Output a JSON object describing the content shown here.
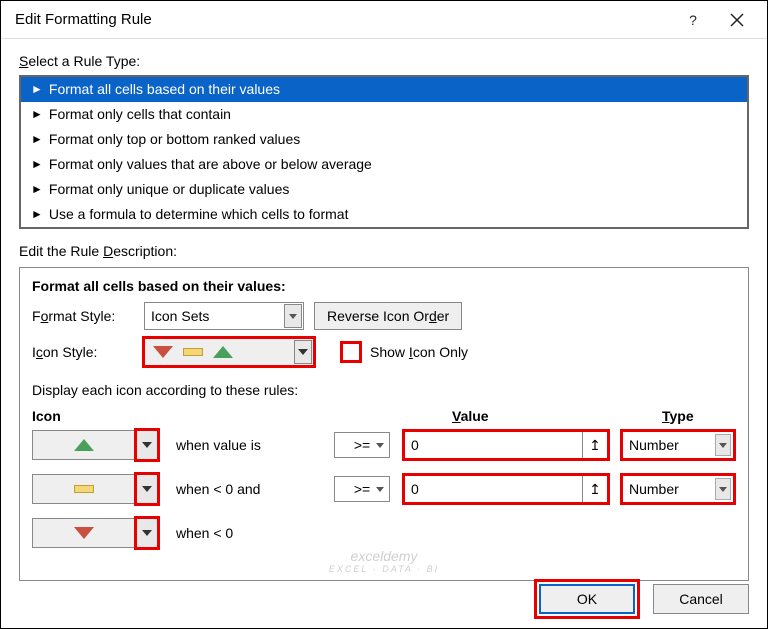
{
  "title": "Edit Formatting Rule",
  "section_rule_type_pre": "S",
  "section_rule_type_post": "elect a Rule Type:",
  "rule_types": [
    "Format all cells based on their values",
    "Format only cells that contain",
    "Format only top or bottom ranked values",
    "Format only values that are above or below average",
    "Format only unique or duplicate values",
    "Use a formula to determine which cells to format"
  ],
  "edit_desc_pre": "Edit the Rule ",
  "edit_desc_ul": "D",
  "edit_desc_post": "escription:",
  "format_header": "Format all cells based on their values:",
  "format_style_pre": "F",
  "format_style_ul": "o",
  "format_style_post": "rmat Style:",
  "format_style_value": "Icon Sets",
  "reverse_pre": "Reverse Icon Or",
  "reverse_ul": "d",
  "reverse_post": "er",
  "icon_style_pre": "I",
  "icon_style_ul": "c",
  "icon_style_post": "on Style:",
  "show_icon_pre": "Show ",
  "show_icon_ul": "I",
  "show_icon_post": "con Only",
  "display_rules_label": "Display each icon according to these rules:",
  "h_icon": "Icon",
  "h_value_pre": "V",
  "h_value_post": "alue",
  "h_type_pre": "T",
  "h_type_post": "ype",
  "icon_rows": [
    {
      "when": "when value is",
      "op": ">=",
      "value": "0",
      "type": "Number"
    },
    {
      "when": "when < 0 and",
      "op": ">=",
      "value": "0",
      "type": "Number"
    },
    {
      "when": "when < 0",
      "op": "",
      "value": "",
      "type": ""
    }
  ],
  "ok": "OK",
  "cancel": "Cancel",
  "watermark": "exceldemy",
  "watermark_sub": "EXCEL · DATA · BI"
}
